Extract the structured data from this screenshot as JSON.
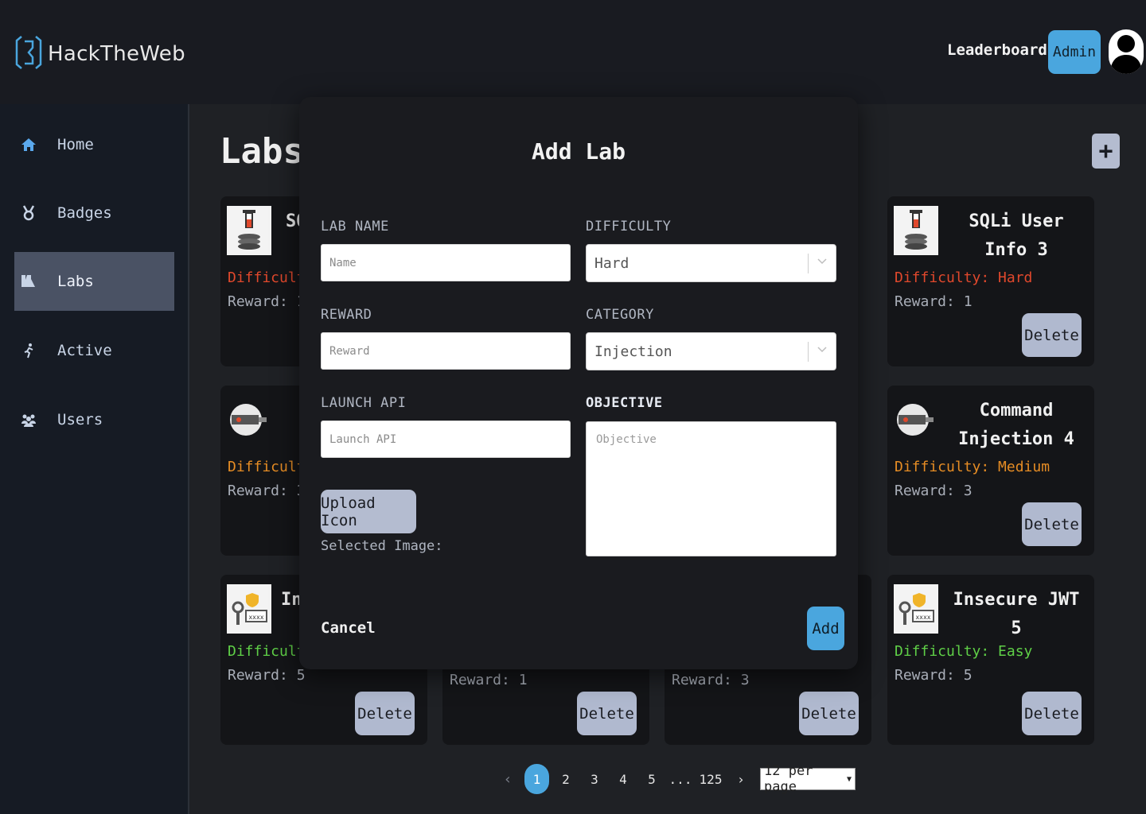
{
  "app": {
    "name": "HackTheWeb"
  },
  "header": {
    "leaderboard": "Leaderboard",
    "admin": "Admin"
  },
  "sidebar": {
    "items": [
      {
        "label": "Home",
        "icon": "home-icon"
      },
      {
        "label": "Badges",
        "icon": "badge-icon"
      },
      {
        "label": "Labs",
        "icon": "flask-icon",
        "active": true
      },
      {
        "label": "Active",
        "icon": "running-icon"
      },
      {
        "label": "Users",
        "icon": "users-icon"
      }
    ]
  },
  "page": {
    "title": "Labs",
    "add_symbol": "+"
  },
  "cards": [
    {
      "title": "SQ",
      "difficulty": "Difficulty",
      "reward": "Reward: 1",
      "icon": "sql-injection-icon",
      "level": "hard"
    },
    {
      "title": "SQLi User Info 3",
      "difficulty": "Difficulty: Hard",
      "reward": "Reward: 1",
      "icon": "sql-injection-icon",
      "level": "hard",
      "delete": "Delete"
    },
    {
      "title": "",
      "difficulty": "Difficulty",
      "reward": "Reward: 3",
      "icon": "command-injection-icon",
      "level": "medium"
    },
    {
      "title": "Command Injection 4",
      "difficulty": "Difficulty: Medium",
      "reward": "Reward: 3",
      "icon": "command-injection-icon",
      "level": "medium",
      "delete": "Delete"
    },
    {
      "title": "In",
      "difficulty": "Difficulty",
      "reward": "Reward: 5",
      "icon": "jwt-key-icon",
      "level": "easy",
      "delete": "Delete"
    },
    {
      "title": "",
      "difficulty": "",
      "reward": "Reward: 1",
      "icon": "",
      "level": "",
      "delete": "Delete"
    },
    {
      "title": "",
      "difficulty": "",
      "reward": "Reward: 3",
      "icon": "",
      "level": "",
      "delete": "Delete"
    },
    {
      "title": "Insecure JWT 5",
      "difficulty": "Difficulty: Easy",
      "reward": "Reward: 5",
      "icon": "jwt-key-icon",
      "level": "easy",
      "delete": "Delete"
    }
  ],
  "pagination": {
    "prev": "‹",
    "pages": [
      "1",
      "2",
      "3",
      "4",
      "5",
      "...",
      "125"
    ],
    "current": "1",
    "next": "›",
    "per_page": "12 per page"
  },
  "modal": {
    "title": "Add Lab",
    "lab_name_label": "LAB NAME",
    "lab_name_placeholder": "Name",
    "difficulty_label": "DIFFICULTY",
    "difficulty_value": "Hard",
    "reward_label": "REWARD",
    "reward_placeholder": "Reward",
    "category_label": "CATEGORY",
    "category_value": "Injection",
    "launch_api_label": "LAUNCH API",
    "launch_api_placeholder": "Launch API",
    "objective_label": "OBJECTIVE",
    "objective_placeholder": "Objective",
    "upload_label": "Upload Icon",
    "selected_image": "Selected Image:",
    "cancel": "Cancel",
    "add": "Add"
  },
  "colors": {
    "accent": "#4aa6de",
    "hard": "#e0482c",
    "medium": "#e58c24",
    "easy": "#5fcf47"
  }
}
